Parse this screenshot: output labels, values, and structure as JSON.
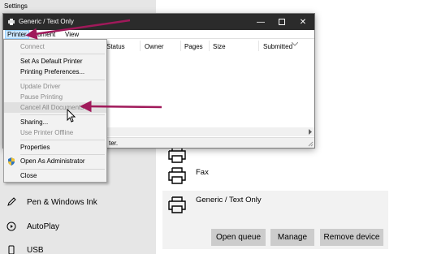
{
  "settings": {
    "title": "Settings",
    "sidebar_items": [
      {
        "label": "Pen & Windows Ink",
        "icon": "pen-icon"
      },
      {
        "label": "AutoPlay",
        "icon": "autoplay-icon"
      },
      {
        "label": "USB",
        "icon": "usb-icon"
      }
    ],
    "devices": [
      {
        "label": "Fax"
      },
      {
        "label": "Generic / Text Only"
      }
    ],
    "buttons": {
      "open_queue": "Open queue",
      "manage": "Manage",
      "remove_device": "Remove device"
    }
  },
  "queue_window": {
    "title": "Generic / Text Only",
    "menus": [
      "Printer",
      "Document",
      "View"
    ],
    "visible_menu_text": {
      "document": "ument"
    },
    "columns": {
      "status": "Status",
      "owner": "Owner",
      "pages": "Pages",
      "size": "Size",
      "submitted": "Submitted"
    },
    "status_text": "ter."
  },
  "printer_menu": {
    "items": [
      {
        "label": "Connect",
        "enabled": false
      },
      {
        "label": "Set As Default Printer",
        "enabled": true
      },
      {
        "label": "Printing Preferences...",
        "enabled": true
      },
      {
        "label": "Update Driver",
        "enabled": false
      },
      {
        "label": "Pause Printing",
        "enabled": false
      },
      {
        "label": "Cancel All Documents",
        "enabled": false
      },
      {
        "label": "Sharing...",
        "enabled": true
      },
      {
        "label": "Use Printer Offline",
        "enabled": false
      },
      {
        "label": "Properties",
        "enabled": true
      },
      {
        "label": "Open As Administrator",
        "enabled": true
      },
      {
        "label": "Close",
        "enabled": true
      }
    ]
  },
  "colors": {
    "annotation_arrow": "#a0195a",
    "title_bar": "#2b2b2b",
    "menu_highlight": "#cce8ff"
  }
}
